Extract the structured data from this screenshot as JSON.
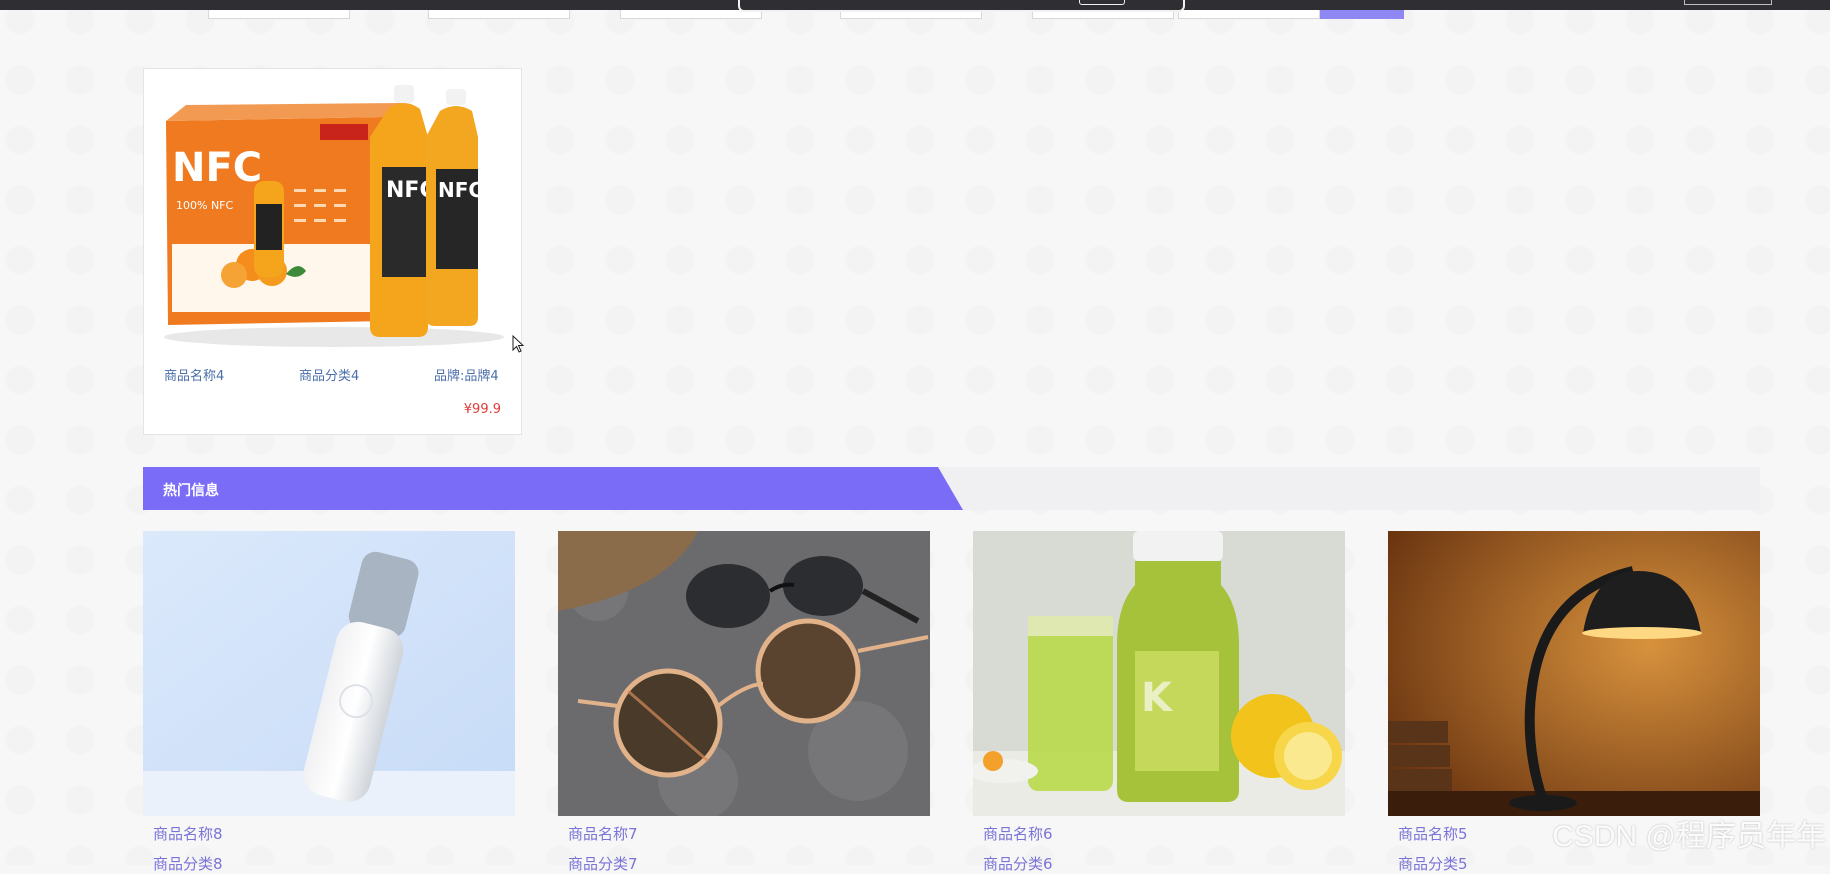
{
  "featured": {
    "name": "商品名称4",
    "category": "商品分类4",
    "brand": "品牌:品牌4",
    "price": "¥99.9",
    "image_icon": "nfc-juice-product-image"
  },
  "hot": {
    "title": "热门信息",
    "items": [
      {
        "name": "商品名称8",
        "category": "商品分类8",
        "image_icon": "spray-bottle-image"
      },
      {
        "name": "商品名称7",
        "category": "商品分类7",
        "image_icon": "sunglasses-image"
      },
      {
        "name": "商品名称6",
        "category": "商品分类6",
        "image_icon": "kiwi-juice-image"
      },
      {
        "name": "商品名称5",
        "category": "商品分类5",
        "image_icon": "desk-lamp-image"
      }
    ]
  },
  "watermark": "CSDN @程序员年年",
  "colors": {
    "accent": "#7b6cf7",
    "price": "#e33b3b",
    "link": "#7a74d6"
  }
}
